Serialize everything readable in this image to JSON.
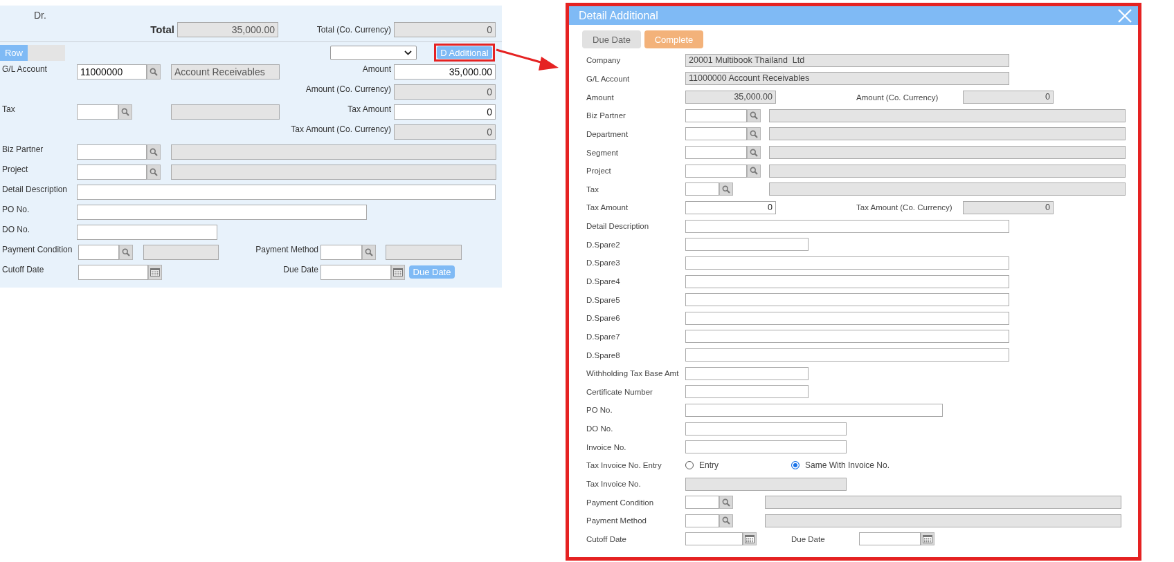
{
  "left_panel": {
    "side_label": "Dr.",
    "total": {
      "label": "Total",
      "value": "35,000.00"
    },
    "total_co_currency": {
      "label": "Total (Co. Currency)",
      "value": "0"
    },
    "tabs": [
      {
        "label": "Row",
        "selected": true
      }
    ],
    "additional_button": {
      "label": "D Additional",
      "highlighted": true
    },
    "rows": [
      {
        "label": "G/L Account",
        "fields": [
          {
            "kind": "lookup",
            "value": "11000000"
          },
          {
            "kind": "readonly",
            "value": "Account Receivables"
          }
        ],
        "label2": "Amount",
        "fields2": [
          {
            "kind": "amount-input",
            "value": "35,000.00"
          }
        ]
      },
      {
        "label2": "Amount (Co. Currency)",
        "fields2": [
          {
            "kind": "amount-readonly",
            "value": "0"
          }
        ]
      },
      {
        "label": "Tax",
        "fields": [
          {
            "kind": "lookup"
          },
          {
            "kind": "readonly"
          }
        ],
        "label2": "Tax Amount",
        "fields2": [
          {
            "kind": "amount-input",
            "value": "0"
          }
        ]
      },
      {
        "label2": "Tax Amount (Co. Currency)",
        "fields2": [
          {
            "kind": "amount-readonly",
            "value": "0"
          }
        ]
      },
      {
        "label": "Biz Partner",
        "fields": [
          {
            "kind": "lookup"
          },
          {
            "kind": "readonly"
          }
        ]
      },
      {
        "label": "Project",
        "fields": [
          {
            "kind": "lookup"
          },
          {
            "kind": "readonly"
          }
        ]
      },
      {
        "label": "Detail Description",
        "fields": [
          {
            "kind": "text"
          }
        ]
      },
      {
        "label": "PO No.",
        "fields": [
          {
            "kind": "text"
          }
        ]
      },
      {
        "label": "DO No.",
        "fields": [
          {
            "kind": "text"
          }
        ]
      },
      {
        "label": "Payment Condition",
        "fields": [
          {
            "kind": "lookup"
          },
          {
            "kind": "readonly"
          }
        ],
        "label2": "Payment Method",
        "fields2": [
          {
            "kind": "lookup"
          },
          {
            "kind": "readonly"
          }
        ]
      },
      {
        "label": "Cutoff Date",
        "fields": [
          {
            "kind": "date"
          }
        ],
        "label2": "Due Date",
        "fields2": [
          {
            "kind": "date"
          },
          {
            "kind": "button",
            "label": "Due Date"
          }
        ]
      }
    ]
  },
  "dialog": {
    "title": "Detail Additional",
    "buttons": [
      {
        "label": "Due Date",
        "kind": "secondary"
      },
      {
        "label": "Complete",
        "kind": "primary"
      }
    ],
    "rows": [
      {
        "label": "Company",
        "fields": [
          {
            "kind": "readonly",
            "value": "20001 Multibook Thailand  Ltd"
          }
        ]
      },
      {
        "label": "G/L Account",
        "fields": [
          {
            "kind": "readonly",
            "value": "11000000 Account Receivables"
          }
        ]
      },
      {
        "label": "Amount",
        "fields": [
          {
            "kind": "amount-readonly",
            "value": "35,000.00"
          }
        ],
        "label2": "Amount (Co. Currency)",
        "fields2": [
          {
            "kind": "amount-readonly",
            "value": "0"
          }
        ]
      },
      {
        "label": "Biz Partner",
        "fields": [
          {
            "kind": "lookup"
          },
          {
            "kind": "readonly"
          }
        ]
      },
      {
        "label": "Department",
        "fields": [
          {
            "kind": "lookup"
          },
          {
            "kind": "readonly"
          }
        ]
      },
      {
        "label": "Segment",
        "fields": [
          {
            "kind": "lookup"
          },
          {
            "kind": "readonly"
          }
        ]
      },
      {
        "label": "Project",
        "fields": [
          {
            "kind": "lookup"
          },
          {
            "kind": "readonly"
          }
        ]
      },
      {
        "label": "Tax",
        "fields": [
          {
            "kind": "lookup"
          },
          {
            "kind": "readonly"
          }
        ]
      },
      {
        "label": "Tax Amount",
        "fields": [
          {
            "kind": "amount-input",
            "value": "0"
          }
        ],
        "label2": "Tax Amount (Co. Currency)",
        "fields2": [
          {
            "kind": "amount-readonly",
            "value": "0"
          }
        ]
      },
      {
        "label": "Detail Description",
        "fields": [
          {
            "kind": "text"
          }
        ]
      },
      {
        "label": "D.Spare2",
        "fields": [
          {
            "kind": "text"
          }
        ]
      },
      {
        "label": "D.Spare3",
        "fields": [
          {
            "kind": "text"
          }
        ]
      },
      {
        "label": "D.Spare4",
        "fields": [
          {
            "kind": "text"
          }
        ]
      },
      {
        "label": "D.Spare5",
        "fields": [
          {
            "kind": "text"
          }
        ]
      },
      {
        "label": "D.Spare6",
        "fields": [
          {
            "kind": "text"
          }
        ]
      },
      {
        "label": "D.Spare7",
        "fields": [
          {
            "kind": "text"
          }
        ]
      },
      {
        "label": "D.Spare8",
        "fields": [
          {
            "kind": "text"
          }
        ]
      },
      {
        "label": "Withholding Tax Base Amt",
        "fields": [
          {
            "kind": "text"
          }
        ]
      },
      {
        "label": "Certificate Number",
        "fields": [
          {
            "kind": "text"
          }
        ]
      },
      {
        "label": "PO No.",
        "fields": [
          {
            "kind": "text"
          }
        ]
      },
      {
        "label": "DO No.",
        "fields": [
          {
            "kind": "text"
          }
        ]
      },
      {
        "label": "Invoice No.",
        "fields": [
          {
            "kind": "text"
          }
        ]
      },
      {
        "label": "Tax Invoice No. Entry",
        "options": [
          {
            "label": "Entry",
            "selected": false
          },
          {
            "label": "Same With Invoice No.",
            "selected": true
          }
        ]
      },
      {
        "label": "Tax Invoice No.",
        "fields": [
          {
            "kind": "readonly"
          }
        ]
      },
      {
        "label": "Payment Condition",
        "fields": [
          {
            "kind": "lookup"
          },
          {
            "kind": "readonly"
          }
        ]
      },
      {
        "label": "Payment Method",
        "fields": [
          {
            "kind": "lookup"
          },
          {
            "kind": "readonly"
          }
        ]
      },
      {
        "label": "Cutoff Date",
        "fields": [
          {
            "kind": "date"
          }
        ],
        "label2": "Due Date",
        "fields2": [
          {
            "kind": "date"
          }
        ]
      }
    ]
  }
}
